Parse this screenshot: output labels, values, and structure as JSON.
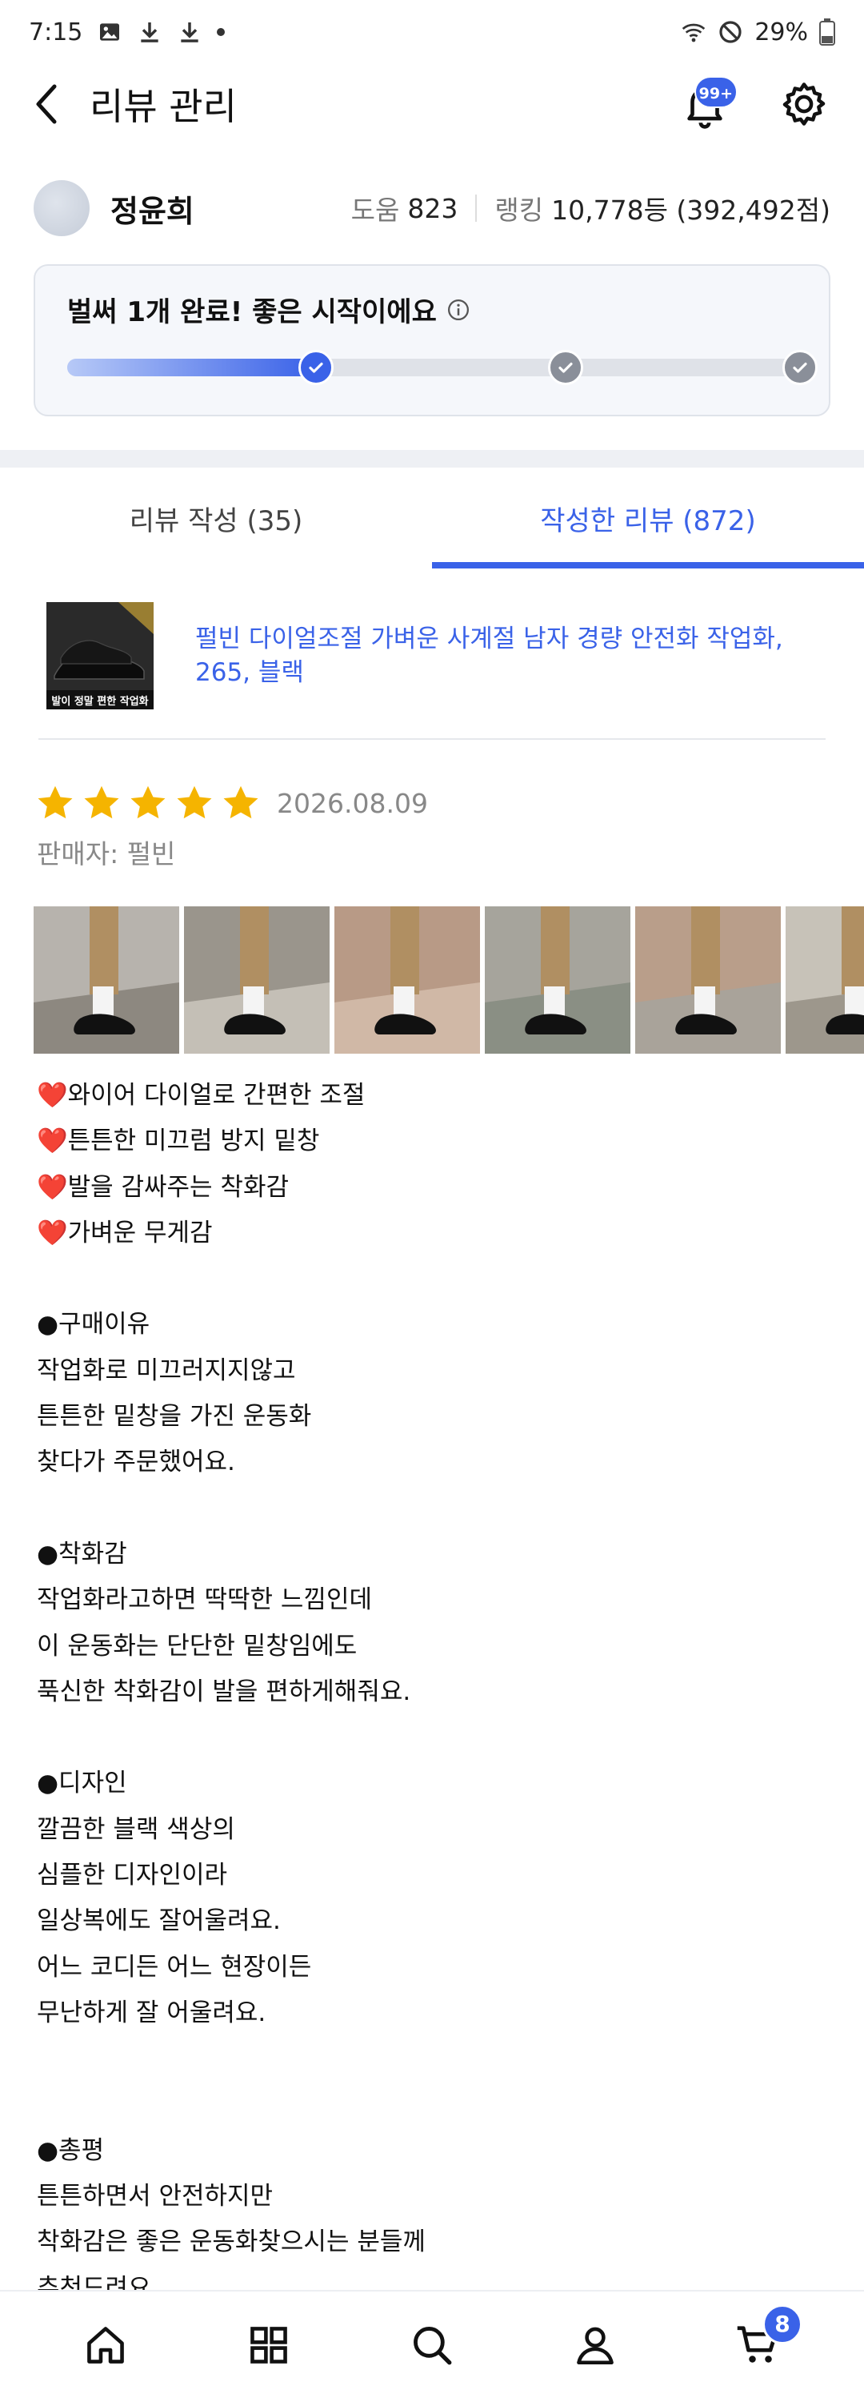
{
  "status_bar": {
    "time": "7:15",
    "battery": "29%"
  },
  "header": {
    "title": "리뷰 관리",
    "notification_badge": "99+"
  },
  "profile": {
    "name": "정윤희",
    "help_label": "도움",
    "help_value": "823",
    "rank_label": "랭킹",
    "rank_value": "10,778등 (392,492점)"
  },
  "progress": {
    "title": "벌써 1개 완료! 좋은 시작이에요",
    "fraction": 0.34,
    "steps": [
      "done",
      "todo",
      "todo"
    ]
  },
  "tabs": [
    {
      "label": "리뷰 작성 (35)",
      "active": false
    },
    {
      "label": "작성한 리뷰 (872)",
      "active": true
    }
  ],
  "product": {
    "name": "펄빈 다이얼조절 가벼운 사계절 남자 경량 안전화 작업화, 265, 블랙",
    "thumb_caption": "발이 정말 편한 작업화"
  },
  "review": {
    "rating": 5,
    "date": "2026.08.09",
    "seller": "판매자: 펄빈",
    "photo_count": 6,
    "lines": [
      "❤️와이어 다이얼로 간편한 조절",
      "❤️튼튼한 미끄럼 방지 밑창",
      "❤️발을 감싸주는 착화감",
      "❤️가벼운 무게감",
      "",
      "●구매이유",
      "작업화로 미끄러지지않고",
      "튼튼한 밑창을 가진 운동화",
      "찾다가 주문했어요.",
      "",
      "●착화감",
      "작업화라고하면 딱딱한 느낌인데",
      "이 운동화는 단단한 밑창임에도",
      "푹신한 착화감이 발을 편하게해줘요.",
      "",
      "●디자인",
      "깔끔한 블랙 색상의",
      "심플한 디자인이라",
      "일상복에도 잘어울려요.",
      "어느 코디든 어느 현장이든",
      "무난하게 잘 어울려요.",
      "",
      "",
      "●총평",
      "튼튼하면서 안전하지만",
      "착화감은 좋은 운동화찾으시는 분들께",
      "추천드려요."
    ]
  },
  "bottom_nav": {
    "items": [
      "home-icon",
      "category-icon",
      "search-icon",
      "profile-icon",
      "cart-icon"
    ],
    "cart_badge": "8"
  },
  "colors": {
    "accent": "#3a62e8",
    "star": "#f5b400"
  }
}
